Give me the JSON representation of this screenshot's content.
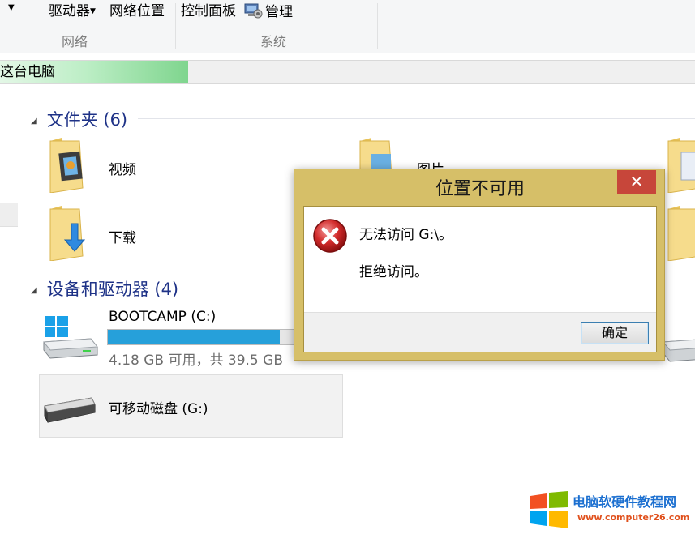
{
  "ribbon": {
    "drives_label": "驱动器",
    "network_location_label": "网络位置",
    "control_panel_label": "控制面板",
    "manage_label": "管理",
    "group_network": "网络",
    "group_system": "系统"
  },
  "address": {
    "path": "这台电脑"
  },
  "folders_group": {
    "title": "文件夹 (6)",
    "items": [
      {
        "label": "视频",
        "icon": "video-folder-icon"
      },
      {
        "label": "图片",
        "icon": "pictures-folder-icon"
      },
      {
        "label": "下载",
        "icon": "downloads-folder-icon"
      }
    ]
  },
  "devices_group": {
    "title": "设备和驱动器 (4)",
    "drives": [
      {
        "name": "BOOTCAMP (C:)",
        "usage": "4.18 GB 可用，共 39.5 GB",
        "used_fraction": 0.89
      },
      {
        "name": "可移动磁盘 (G:)"
      }
    ]
  },
  "dialog": {
    "title": "位置不可用",
    "close_label": "✕",
    "message": "无法访问 G:\\。",
    "detail": "拒绝访问。",
    "ok_label": "确定"
  },
  "watermark": {
    "title": "电脑软硬件教程网",
    "url": "www.computer26.com"
  },
  "colors": {
    "accent": "#26a0da",
    "dialog_frame": "#d6bf68",
    "close_button": "#c7463a",
    "group_title": "#1e3287"
  }
}
